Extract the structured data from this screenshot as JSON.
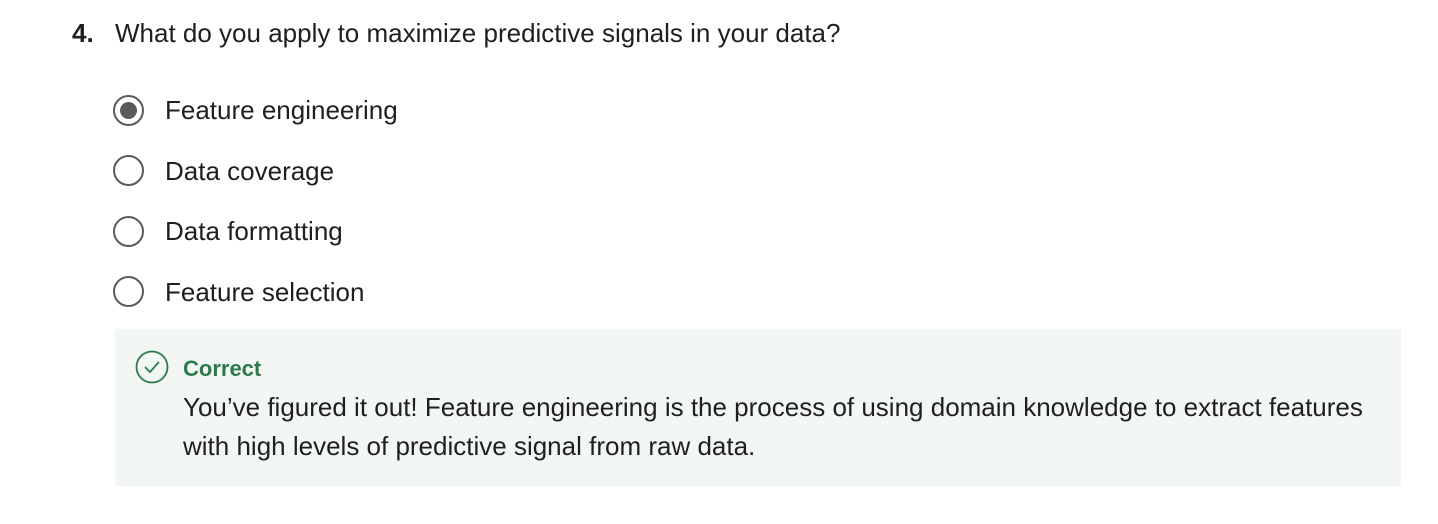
{
  "question": {
    "number": "4.",
    "text": "What do you apply to maximize predictive signals in your data?"
  },
  "options": [
    {
      "label": "Feature engineering",
      "selected": true
    },
    {
      "label": "Data coverage",
      "selected": false
    },
    {
      "label": "Data formatting",
      "selected": false
    },
    {
      "label": "Feature selection",
      "selected": false
    }
  ],
  "feedback": {
    "status": "Correct",
    "icon": "check-circle-icon",
    "status_color": "#2b7a4b",
    "background_color": "#f3f7f4",
    "explanation": "You’ve figured it out! Feature engineering is the process of using domain knowledge to extract features with high levels of predictive signal from raw data."
  }
}
